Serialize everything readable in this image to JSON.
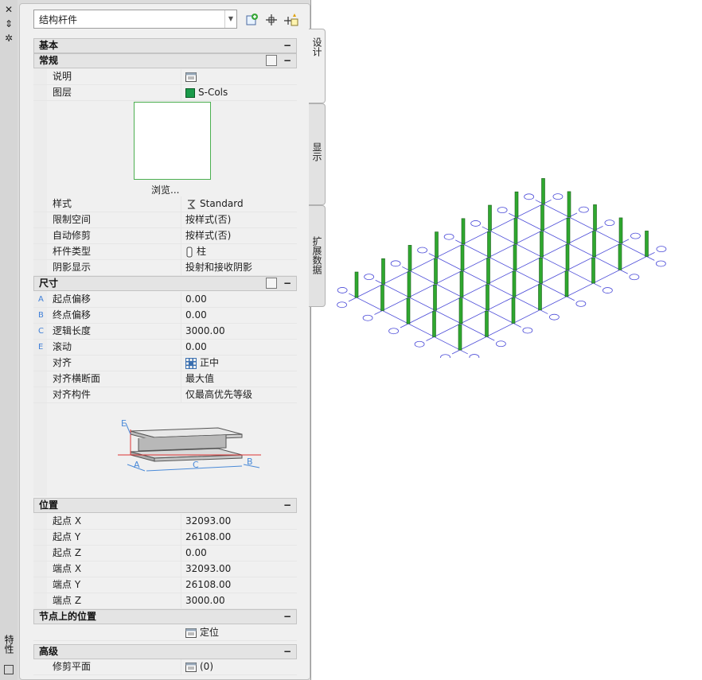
{
  "titlebar": {
    "title": "特性",
    "close": "✕",
    "auto_hide": "⇕",
    "options": "✲"
  },
  "type_selector": {
    "value": "结构杆件"
  },
  "tabs": [
    {
      "label": "设计"
    },
    {
      "label": "显示"
    },
    {
      "label": "扩展数据"
    }
  ],
  "sections": {
    "basic": {
      "label": "基本",
      "collapse": "−"
    },
    "general": {
      "label": "常规",
      "collapse": "−"
    },
    "dimensions": {
      "label": "尺寸",
      "collapse": "−"
    },
    "location": {
      "label": "位置",
      "collapse": "−"
    },
    "node_location": {
      "label": "节点上的位置",
      "collapse": "−"
    },
    "advanced": {
      "label": "高级",
      "collapse": "−"
    }
  },
  "general": {
    "description": {
      "label": "说明"
    },
    "layer": {
      "label": "图层",
      "value": "S-Cols",
      "color": "#1a9a4a"
    },
    "browse": "浏览...",
    "style": {
      "label": "样式",
      "value": "Standard"
    },
    "bound_space": {
      "label": "限制空间",
      "value": "按样式(否)"
    },
    "auto_trim": {
      "label": "自动修剪",
      "value": "按样式(否)"
    },
    "member_type": {
      "label": "杆件类型",
      "value": "柱"
    },
    "shadow": {
      "label": "阴影显示",
      "value": "投射和接收阴影"
    }
  },
  "dimensions": {
    "start_offset": {
      "mark": "A",
      "label": "起点偏移",
      "value": "0.00"
    },
    "end_offset": {
      "mark": "B",
      "label": "终点偏移",
      "value": "0.00"
    },
    "logical_length": {
      "mark": "C",
      "label": "逻辑长度",
      "value": "3000.00"
    },
    "roll": {
      "mark": "E",
      "label": "滚动",
      "value": "0.00"
    },
    "justify": {
      "label": "对齐",
      "value": "正中"
    },
    "justify_section": {
      "label": "对齐横断面",
      "value": "最大值"
    },
    "justify_members": {
      "label": "对齐构件",
      "value": "仅最高优先等级"
    },
    "diagram": {
      "e": "E",
      "a": "A",
      "c": "C",
      "b": "B"
    }
  },
  "location": {
    "start_x": {
      "label": "起点 X",
      "value": "32093.00"
    },
    "start_y": {
      "label": "起点 Y",
      "value": "26108.00"
    },
    "start_z": {
      "label": "起点 Z",
      "value": "0.00"
    },
    "end_x": {
      "label": "端点 X",
      "value": "32093.00"
    },
    "end_y": {
      "label": "端点 Y",
      "value": "26108.00"
    },
    "end_z": {
      "label": "端点 Z",
      "value": "3000.00"
    }
  },
  "node_location": {
    "value": "定位"
  },
  "advanced": {
    "trim_planes": {
      "label": "修剪平面",
      "value": "(0)"
    }
  },
  "colors": {
    "grid_line": "#4a4ad8",
    "column": "#2fa82f",
    "accent": "#3f7fd8"
  }
}
